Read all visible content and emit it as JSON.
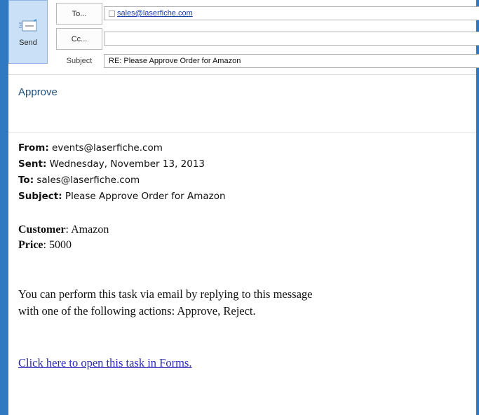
{
  "compose": {
    "send_label": "Send",
    "to_button": "To...",
    "cc_button": "Cc...",
    "subject_label": "Subject",
    "to_recipients": [
      "sales@laserfiche.com"
    ],
    "cc_value": "",
    "subject_value": "RE: Please Approve Order for Amazon"
  },
  "body": {
    "reply_text": "Approve",
    "original": {
      "from_label": "From:",
      "from_value": " events@laserfiche.com",
      "sent_label": "Sent:",
      "sent_value": " Wednesday, November 13, 2013",
      "to_label": "To:",
      "to_value": " sales@laserfiche.com",
      "subject_label": "Subject:",
      "subject_value": " Please Approve Order for Amazon"
    },
    "customer_label": "Customer",
    "customer_value": ": Amazon",
    "price_label": "Price",
    "price_value": ": 5000",
    "instructions_line1": "You can perform this task via email by replying to this message",
    "instructions_line2": "with one of the following actions: Approve, Reject.",
    "forms_link": "Click here to open this task in Forms."
  },
  "colors": {
    "frame": "#2f78c2",
    "send_button_bg": "#c9e0f7",
    "reply_text": "#1f4e79",
    "link": "#2a2ab8"
  },
  "icons": {
    "send": "send-envelope-icon",
    "recipient": "recipient-checkbox-icon"
  }
}
